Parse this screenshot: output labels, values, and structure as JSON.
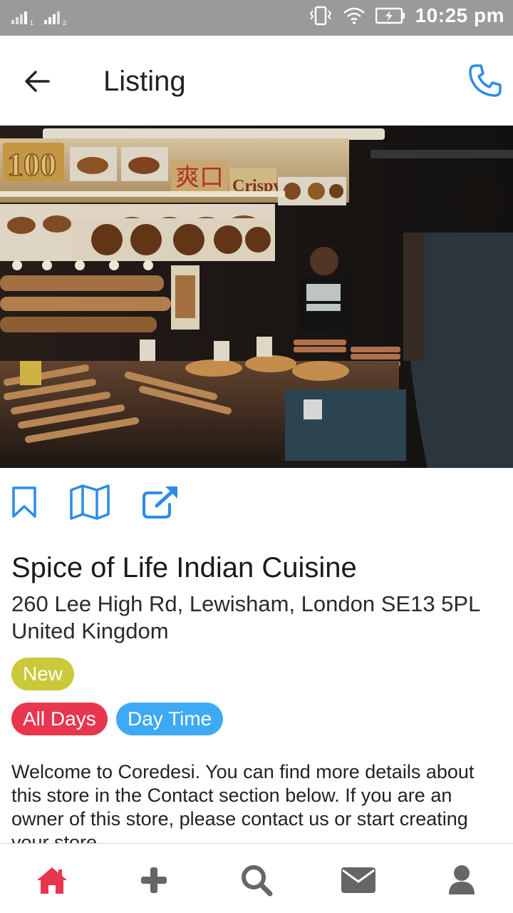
{
  "status_bar": {
    "time": "10:25 pm",
    "sim1": "1",
    "sim2": "2",
    "icons": [
      "signal-icon",
      "signal-icon",
      "vibrate-icon",
      "wifi-icon",
      "battery-charging-icon"
    ]
  },
  "app_bar": {
    "title": "Listing",
    "back_icon": "arrow-left-icon",
    "call_icon": "phone-icon"
  },
  "hero": {
    "sign_number": "100",
    "sign_chinese": "爽口",
    "sign_crispy": "Crispy"
  },
  "actions": [
    {
      "icon": "bookmark-icon"
    },
    {
      "icon": "map-icon"
    },
    {
      "icon": "external-link-icon"
    }
  ],
  "listing": {
    "name": "Spice of Life Indian Cuisine",
    "address": "260 Lee High Rd, Lewisham, London SE13 5PL United Kingdom",
    "tags": {
      "status": "New",
      "days": "All Days",
      "time": "Day Time"
    },
    "description": "Welcome to Coredesi. You can find more details about this store in the Contact section below. If you are an owner of this store, please contact us or start creating your store."
  },
  "bottom_nav": [
    {
      "icon": "home-icon",
      "active": true
    },
    {
      "icon": "plus-icon",
      "active": false
    },
    {
      "icon": "search-icon",
      "active": false
    },
    {
      "icon": "mail-icon",
      "active": false
    },
    {
      "icon": "user-icon",
      "active": false
    }
  ],
  "colors": {
    "accent_blue": "#2b8ce8",
    "status_bar": "#9a9a9a",
    "badge_new": "#c9c93a",
    "badge_days": "#e8364f",
    "badge_time": "#3ea9f5",
    "nav_active": "#e8364f",
    "nav_inactive": "#666666"
  }
}
